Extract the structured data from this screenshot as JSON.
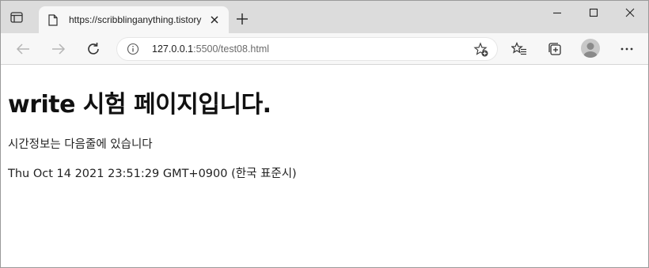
{
  "browser": {
    "tab": {
      "title": "https://scribblinganything.tistory",
      "close_label": "×"
    },
    "new_tab_label": "+",
    "address_bar": {
      "url_host": "127.0.0.1",
      "url_rest": ":5500/test08.html"
    }
  },
  "page": {
    "heading": "write 시험 페이지입니다.",
    "line1": "시간정보는 다음줄에 있습니다",
    "line2": "Thu Oct 14 2021 23:51:29 GMT+0900 (한국 표준시)"
  },
  "icons": {
    "tab_actions": "tab-actions-icon",
    "favicon": "page-icon",
    "back": "back-arrow-icon",
    "forward": "forward-arrow-icon",
    "refresh": "refresh-icon",
    "site_info": "info-icon",
    "add_favorite": "star-plus-icon",
    "favorites": "favorites-icon",
    "collections": "collections-icon",
    "profile": "avatar",
    "more": "more-icon"
  }
}
